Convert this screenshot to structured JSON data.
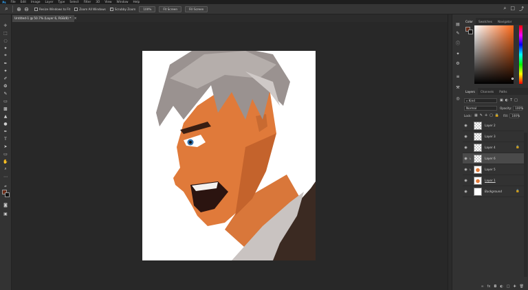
{
  "menubar": {
    "items": [
      "File",
      "Edit",
      "Image",
      "Layer",
      "Type",
      "Select",
      "Filter",
      "3D",
      "View",
      "Window",
      "Help"
    ]
  },
  "optionsbar": {
    "resize_windows_label": "Resize Windows to Fit",
    "zoom_all_windows_label": "Zoom All Windows",
    "scrubby_zoom_label": "Scrubby Zoom",
    "zoom_100_label": "100%",
    "fit_screen_label": "Fit Screen",
    "fill_screen_label": "Fill Screen"
  },
  "document": {
    "tab_title": "Untitled-1 @ 50.7% (Layer 6, RGB/8) *"
  },
  "panels": {
    "color_tabs": [
      "Color",
      "Swatches",
      "Navigator"
    ],
    "layers_tabs": [
      "Layers",
      "Channels",
      "Paths"
    ]
  },
  "layers_panel": {
    "filter_kind": "Kind",
    "blend_mode": "Normal",
    "opacity_label": "Opacity:",
    "opacity_value": "100%",
    "lock_label": "Lock:",
    "fill_label": "Fill:",
    "fill_value": "100%",
    "layers": [
      {
        "name": "Layer 2"
      },
      {
        "name": "Layer 3"
      },
      {
        "name": "Layer 4"
      },
      {
        "name": "Layer 6"
      },
      {
        "name": "Layer 5"
      },
      {
        "name": "Layer 1"
      },
      {
        "name": "Background"
      }
    ]
  },
  "colors": {
    "foreground": "#6b2b16",
    "background": "#111111",
    "accent": "#31a8ff"
  }
}
